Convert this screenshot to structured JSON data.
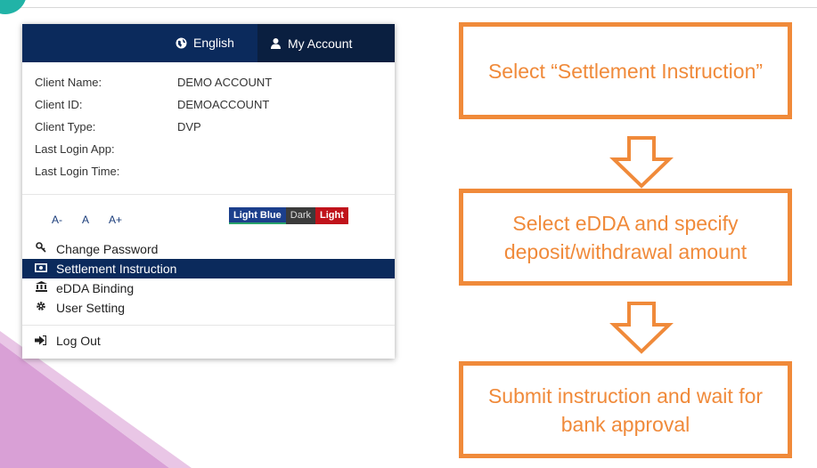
{
  "header": {
    "language_label": "English",
    "account_label": "My Account"
  },
  "client_info": [
    {
      "label": "Client Name:",
      "value": "DEMO ACCOUNT"
    },
    {
      "label": "Client ID:",
      "value": "DEMOACCOUNT"
    },
    {
      "label": "Client Type:",
      "value": "DVP"
    },
    {
      "label": "Last Login App:",
      "value": ""
    },
    {
      "label": "Last Login Time:",
      "value": ""
    }
  ],
  "font_size_controls": [
    "A-",
    "A",
    "A+"
  ],
  "themes": [
    "Light Blue",
    "Dark",
    "Light"
  ],
  "menu": [
    {
      "label": "Change Password",
      "icon": "key-icon"
    },
    {
      "label": "Settlement Instruction",
      "icon": "money-icon",
      "active": true
    },
    {
      "label": "eDDA Binding",
      "icon": "bank-icon"
    },
    {
      "label": "User Setting",
      "icon": "gear-icon"
    }
  ],
  "logout_label": "Log Out",
  "steps": [
    "Select “Settlement Instruction”",
    "Select eDDA and specify deposit/withdrawal amount",
    "Submit instruction and wait for bank approval"
  ],
  "colors": {
    "navy": "#0b2a5c",
    "accent_orange": "#f08a3a",
    "deco_purple": "#d9a0d6",
    "deco_teal": "#21b3a7"
  }
}
